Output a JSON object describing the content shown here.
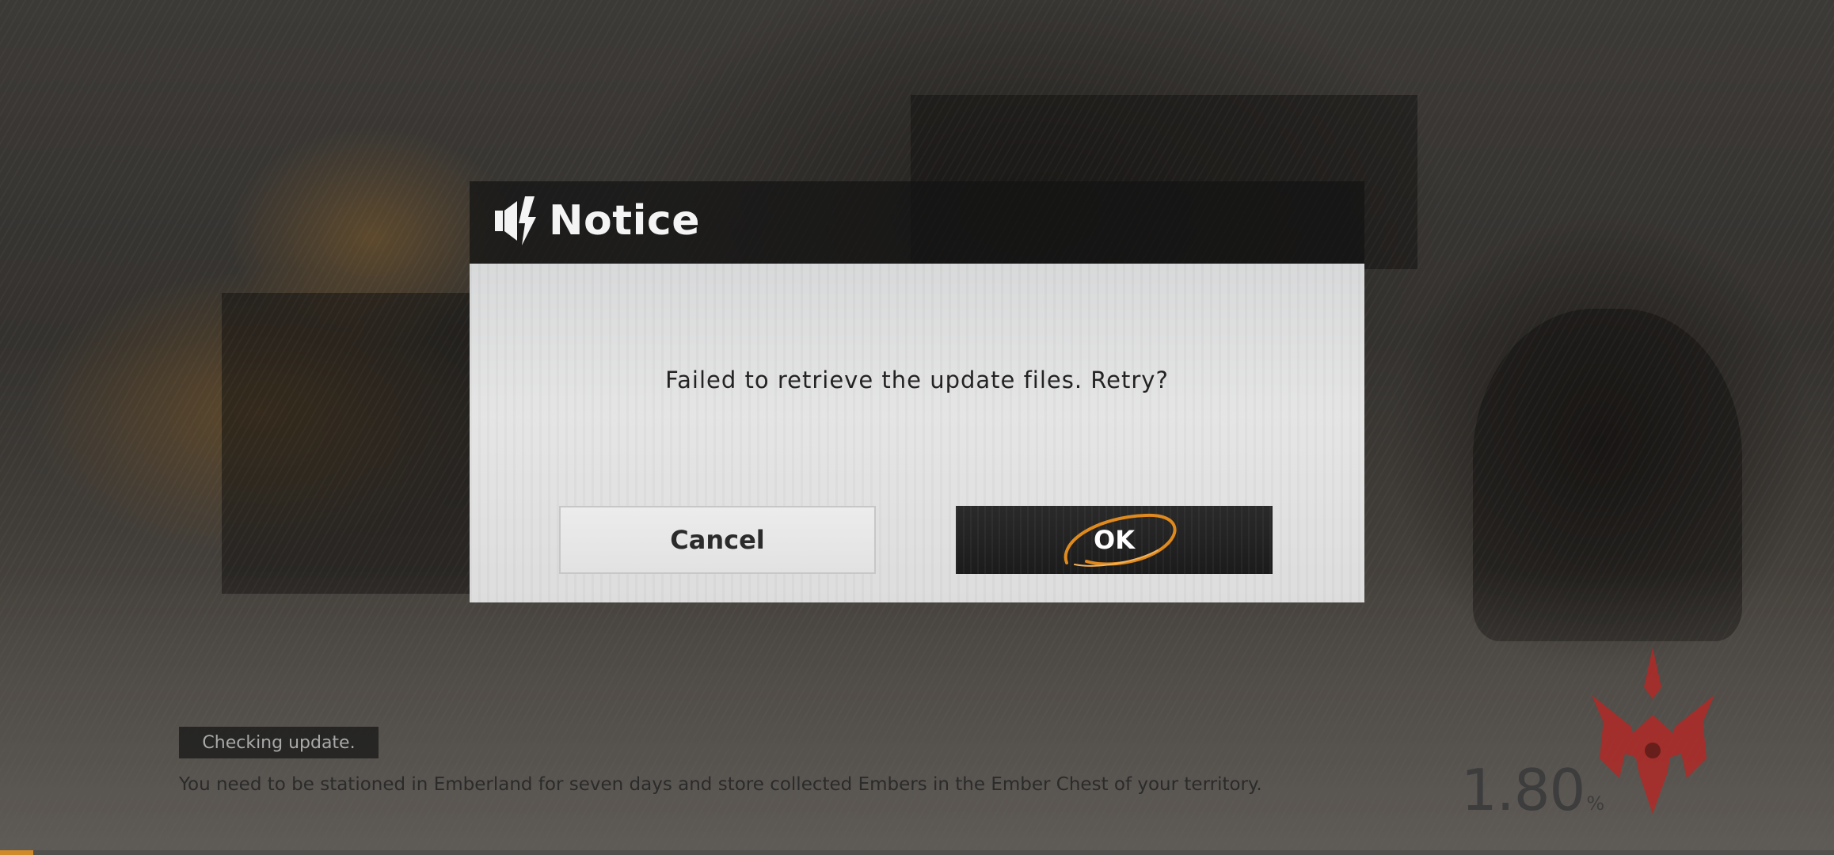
{
  "dialog": {
    "title": "Notice",
    "icon": "notice-speaker-icon",
    "message": "Failed to retrieve the update files. Retry?",
    "cancel_label": "Cancel",
    "ok_label": "OK"
  },
  "loading": {
    "status": "Checking update.",
    "tip": "You need to be stationed in Emberland for seven days and store collected Embers in the Ember Chest of your territory.",
    "progress_value": "1.80",
    "progress_unit": "%",
    "progress_fraction": 0.018
  },
  "colors": {
    "accent_orange": "#e08a1e",
    "emblem_red": "#b02a26",
    "ok_button": "#1f1f1f",
    "cancel_button": "#e6e6e6"
  }
}
